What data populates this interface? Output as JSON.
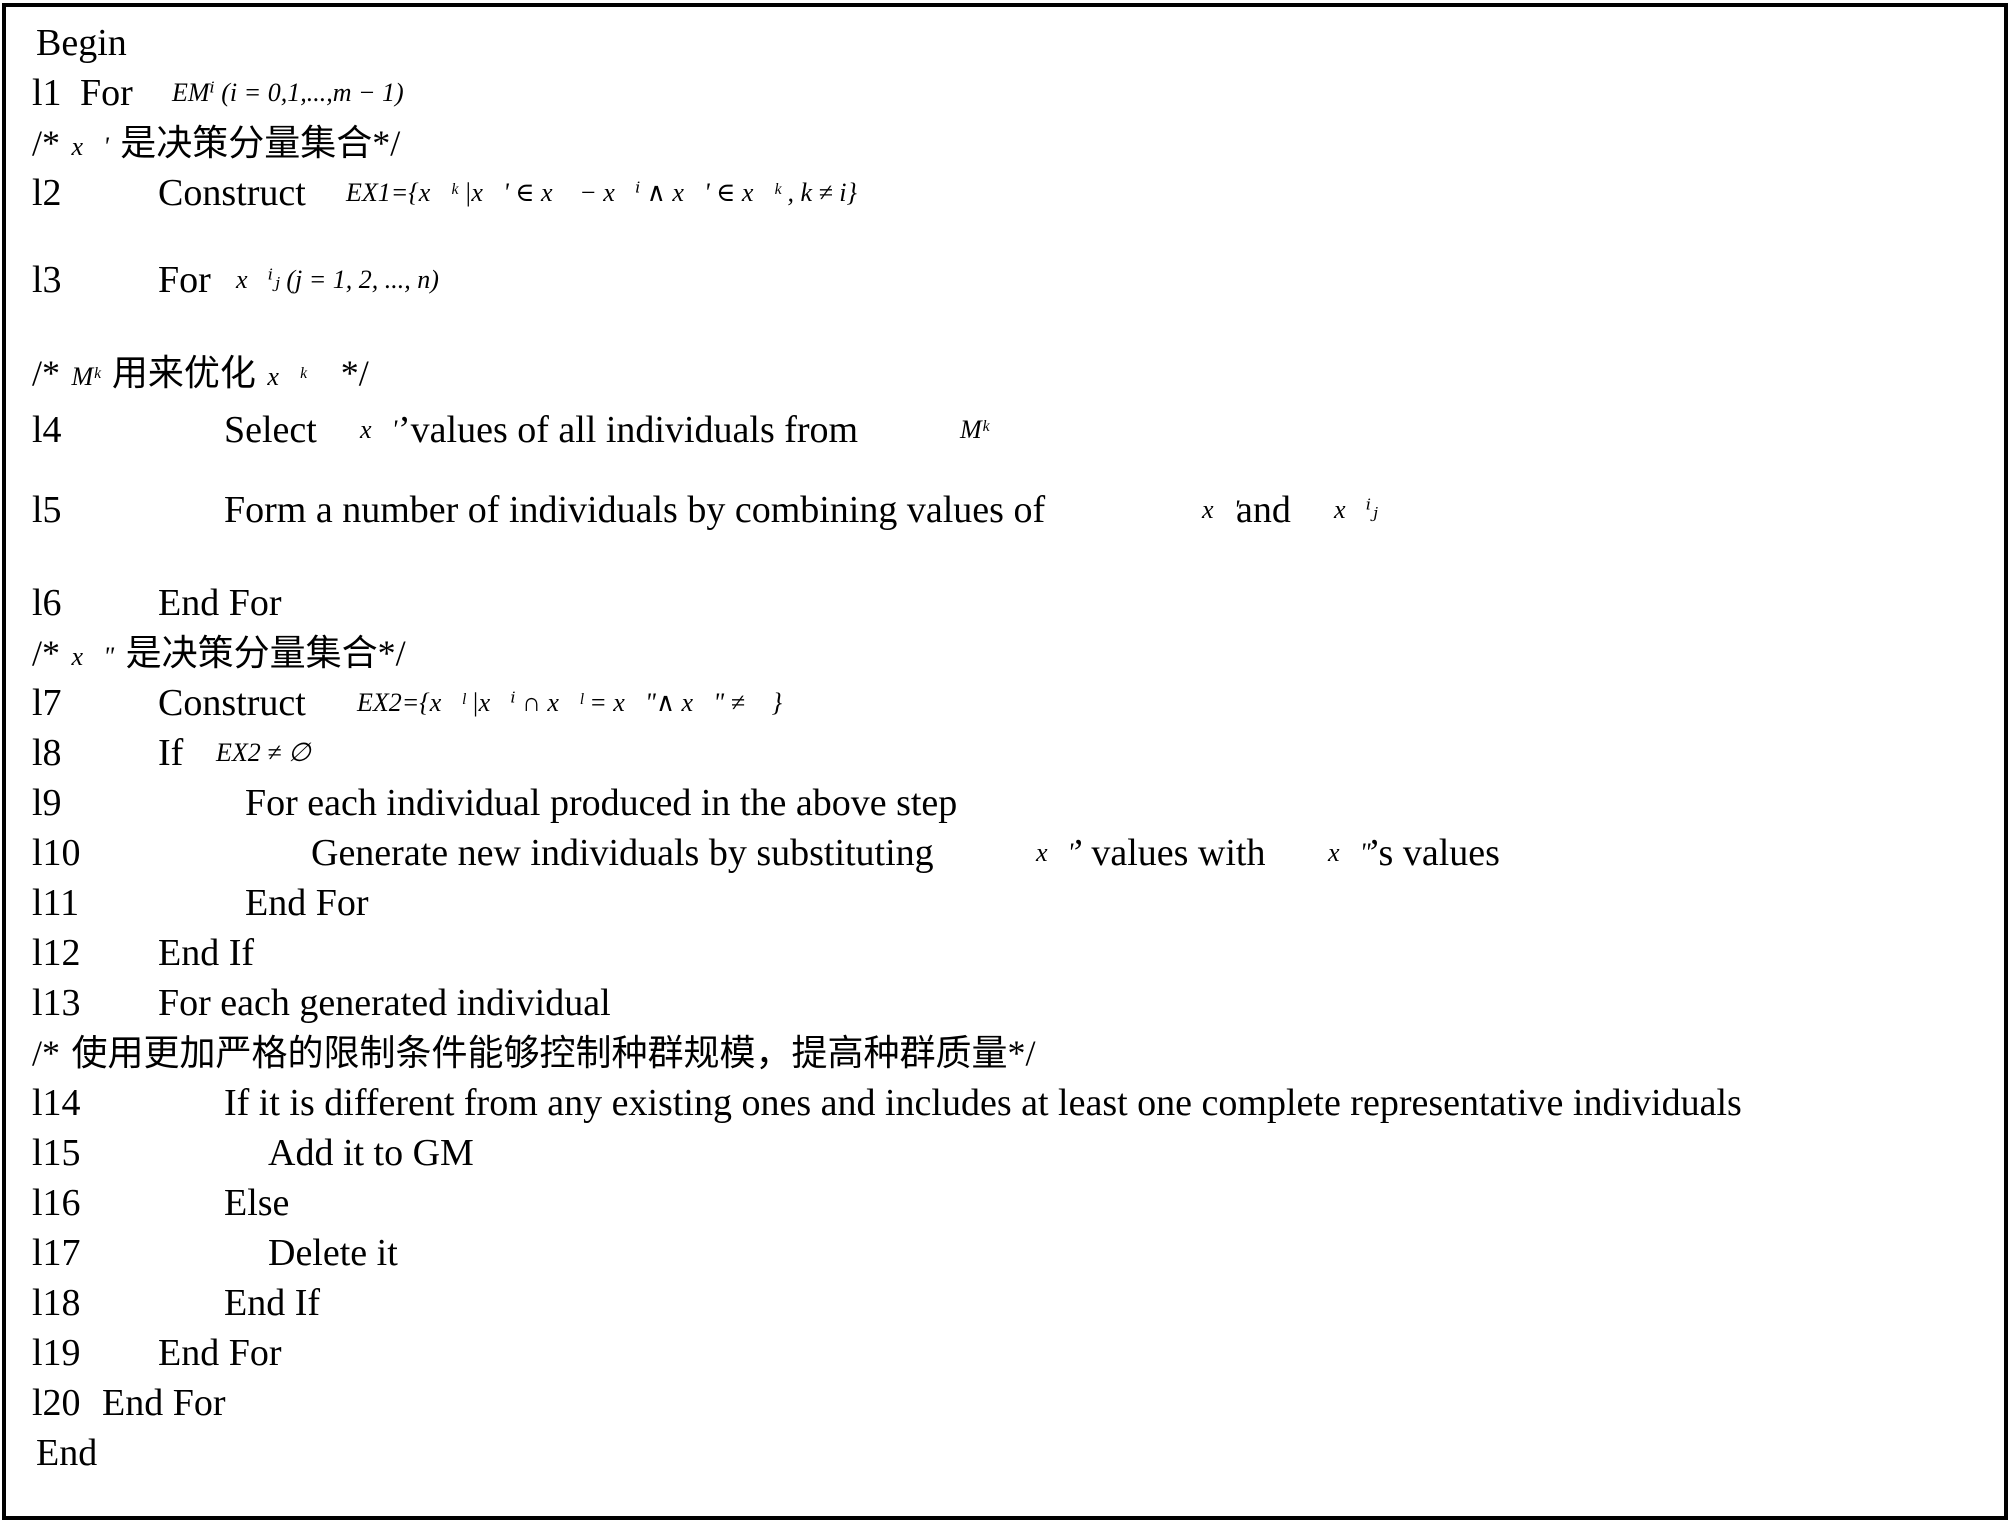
{
  "document": {
    "lines": [
      {
        "id": "begin",
        "number": "",
        "text": "Begin"
      },
      {
        "id": "l1",
        "number": "l1",
        "text": "For",
        "math": "EMⁱ (i = 0,1,...,m − 1)"
      },
      {
        "id": "c1",
        "comment": "/* x⃗' 是决策分量集合*/",
        "comment_math": "x⃗'",
        "comment_text": "是决策分量集合"
      },
      {
        "id": "l2",
        "number": "l2",
        "text": "Construct",
        "math": "EX1={x⃗ᵏ |x⃗' ∈ x⃗ − x⃗ⁱ ∧ x⃗' ∈ x⃗ᵏ , k ≠ i}"
      },
      {
        "id": "l3",
        "number": "l3",
        "text": "For",
        "math": "x⃗ⁱⱼ (j = 1, 2, ..., n)"
      },
      {
        "id": "c2",
        "comment_math_a": "Mᵏ",
        "comment_text": "用来优化",
        "comment_math_b": "x⃗ᵏ"
      },
      {
        "id": "l4",
        "number": "l4",
        "text_a": "Select",
        "math_a": "x⃗'",
        "text_b": "’values of all individuals from",
        "math_b": "Mᵏ"
      },
      {
        "id": "l5",
        "number": "l5",
        "text_a": "Form a number of individuals by combining values of",
        "math_a": "x⃗'",
        "text_b": "and",
        "math_b": "x⃗ⁱⱼ"
      },
      {
        "id": "l6",
        "number": "l6",
        "text": "End For"
      },
      {
        "id": "c3",
        "comment_math": "x⃗\"",
        "comment_text": "是决策分量集合"
      },
      {
        "id": "l7",
        "number": "l7",
        "text": "Construct",
        "math": "EX2={x⃗ˡ |x⃗ⁱ ∩ x⃗ˡ = x⃗\"∧ x⃗\" ≠ ∅}"
      },
      {
        "id": "l8",
        "number": "l8",
        "text": "If",
        "math": "EX2 ≠ ∅"
      },
      {
        "id": "l9",
        "number": "l9",
        "text": "For each individual produced in the above step"
      },
      {
        "id": "l10",
        "number": "l10",
        "text_a": "Generate new individuals by substituting",
        "math_a": "x⃗'",
        "text_b": "’ values with",
        "math_b": "x⃗\"",
        "text_c": "’s values"
      },
      {
        "id": "l11",
        "number": "l11",
        "text": "End For"
      },
      {
        "id": "l12",
        "number": "l12",
        "text": "End If"
      },
      {
        "id": "l13",
        "number": "l13",
        "text": "For each generated individual"
      },
      {
        "id": "c4",
        "comment_text": "使用更加严格的限制条件能够控制种群规模，提高种群质量"
      },
      {
        "id": "l14",
        "number": "l14",
        "text": "If it is different from any existing ones and includes at least one complete representative individuals"
      },
      {
        "id": "l15",
        "number": "l15",
        "text": "Add it to GM"
      },
      {
        "id": "l16",
        "number": "l16",
        "text": "Else"
      },
      {
        "id": "l17",
        "number": "l17",
        "text": "Delete it"
      },
      {
        "id": "l18",
        "number": "l18",
        "text": "End If"
      },
      {
        "id": "l19",
        "number": "l19",
        "text": "End For"
      },
      {
        "id": "l20",
        "number": "l20",
        "text": "End For"
      },
      {
        "id": "end",
        "number": "",
        "text": "End"
      }
    ],
    "comment_open": "/*",
    "comment_close": "*/"
  }
}
